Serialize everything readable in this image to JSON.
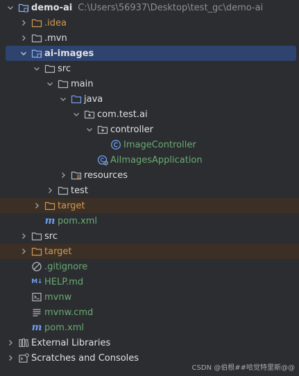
{
  "project": {
    "root_name": "demo-ai",
    "root_path": "C:\\Users\\56937\\Desktop\\test_gc\\demo-ai"
  },
  "tree": {
    "idea": ".idea",
    "mvn": ".mvn",
    "ai_images": "ai-images",
    "src": "src",
    "main": "main",
    "java": "java",
    "package": "com.test.ai",
    "controller": "controller",
    "image_controller": "ImageController",
    "app_class": "AiImagesApplication",
    "resources": "resources",
    "test": "test",
    "target": "target",
    "module_pom": "pom.xml",
    "root_src": "src",
    "root_target": "target",
    "gitignore": ".gitignore",
    "help": "HELP.md",
    "mvnw": "mvnw",
    "mvnw_cmd": "mvnw.cmd",
    "root_pom": "pom.xml",
    "external_libraries": "External Libraries",
    "scratches": "Scratches and Consoles"
  },
  "watermark": "CSDN @伯根##哈觉特里斯@@",
  "colors": {
    "background": "#2b2d30",
    "selection": "#2e436e",
    "excluded_row": "#3c3026",
    "ignored_text": "#d19a52",
    "vcs_added_text": "#6aab73"
  }
}
